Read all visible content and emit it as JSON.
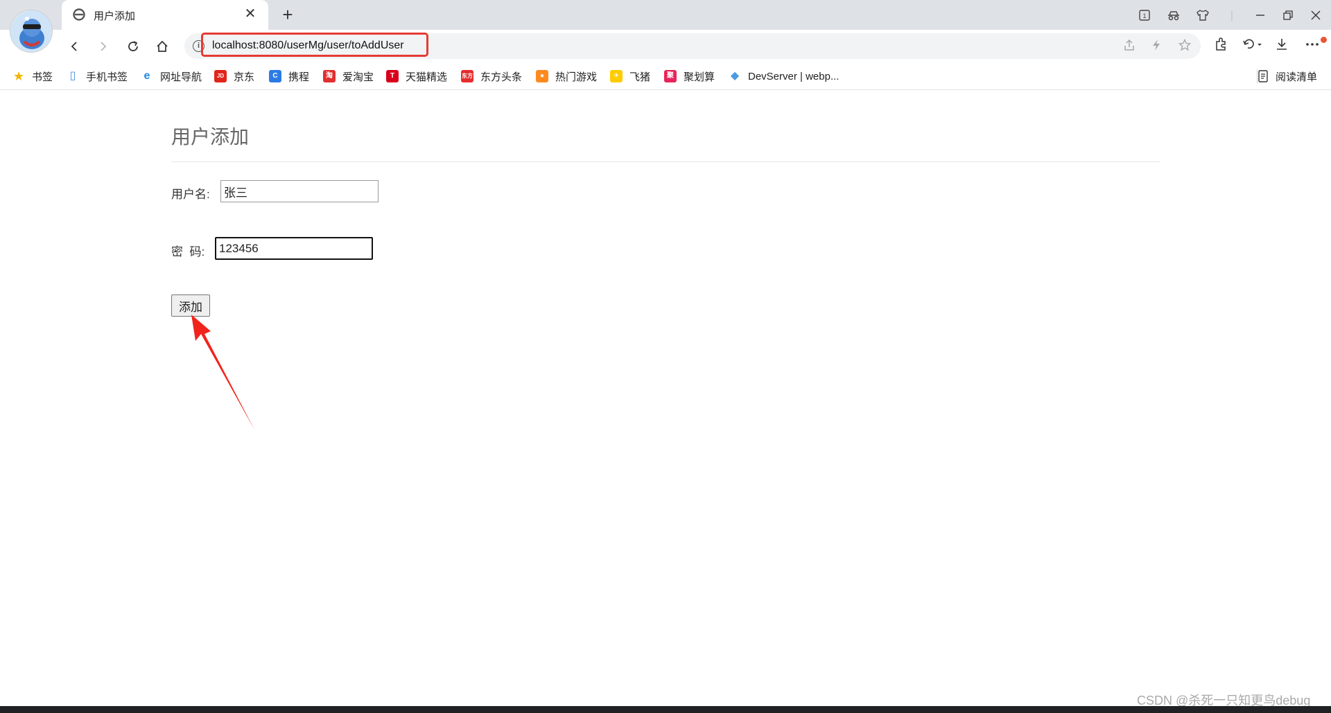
{
  "browser": {
    "tab_title": "用户添加",
    "tab_close": "✕",
    "new_tab": "+",
    "address_url": "localhost:8080/userMg/user/toAddUser",
    "info_glyph": "i",
    "accent_color": "#e53a33"
  },
  "bookmarks": [
    {
      "label": "书签",
      "icon": "star-icon",
      "color": "#f5b400",
      "glyph": "★"
    },
    {
      "label": "手机书签",
      "icon": "phone-icon",
      "color": "#4a90e2",
      "glyph": "▯"
    },
    {
      "label": "网址导航",
      "icon": "e-icon",
      "color": "#1e88e5",
      "glyph": "e"
    },
    {
      "label": "京东",
      "icon": "jd-icon",
      "color": "#e1251b",
      "glyph": "JD"
    },
    {
      "label": "携程",
      "icon": "ctrip-icon",
      "color": "#2c7be5",
      "glyph": "C"
    },
    {
      "label": "爱淘宝",
      "icon": "taobao-icon",
      "color": "#e0302f",
      "glyph": "淘"
    },
    {
      "label": "天猫精选",
      "icon": "tmall-icon",
      "color": "#d8001a",
      "glyph": "T"
    },
    {
      "label": "东方头条",
      "icon": "dongfang-icon",
      "color": "#e62d2d",
      "glyph": "东方"
    },
    {
      "label": "热门游戏",
      "icon": "game-icon",
      "color": "#ff8a1f",
      "glyph": "●"
    },
    {
      "label": "飞猪",
      "icon": "fliggy-icon",
      "color": "#ffcc00",
      "glyph": "✈"
    },
    {
      "label": "聚划算",
      "icon": "juhuasuan-icon",
      "color": "#e8245c",
      "glyph": "聚"
    },
    {
      "label": "DevServer | webp...",
      "icon": "webpack-icon",
      "color": "#4d9be0",
      "glyph": "◆"
    }
  ],
  "reading_list": {
    "label": "阅读清单"
  },
  "page": {
    "title": "用户添加",
    "username_label": "用户名:",
    "username_value": "张三",
    "password_label": "密  码:",
    "password_value": "123456",
    "submit_label": "添加"
  },
  "watermark": "CSDN @杀死一只知更鸟debug"
}
